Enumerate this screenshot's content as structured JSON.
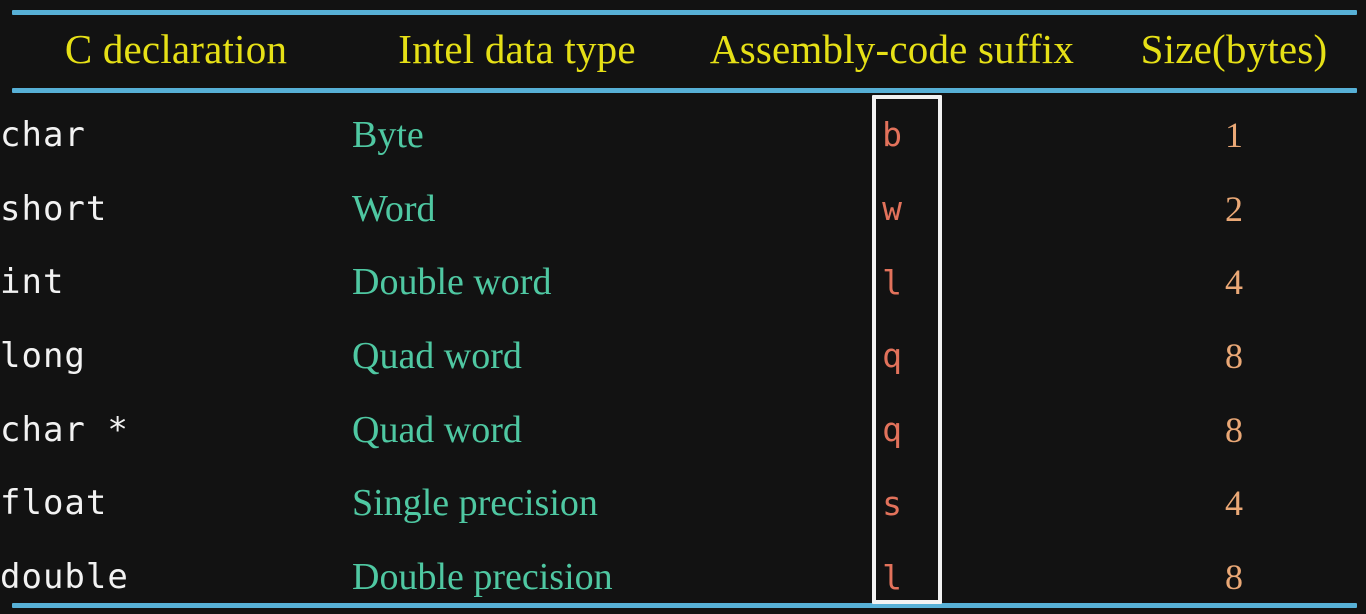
{
  "slide": {
    "background_color": "#121212",
    "rule_color": "#57b0d6",
    "header_color": "#e6e016",
    "declaration_color": "#f2f2f2",
    "intel_type_color": "#4fc8a2",
    "suffix_color": "#e2725b",
    "size_color": "#eaa876",
    "highlight_border_color": "#f2f2f2"
  },
  "table": {
    "headers": {
      "declaration": "C declaration",
      "intel_type": "Intel data type",
      "suffix": "Assembly-code suffix",
      "size": "Size(bytes)"
    },
    "rows": [
      {
        "declaration": "char",
        "intel_type": "Byte",
        "suffix": "b",
        "size": "1"
      },
      {
        "declaration": "short",
        "intel_type": "Word",
        "suffix": "w",
        "size": "2"
      },
      {
        "declaration": "int",
        "intel_type": "Double word",
        "suffix": "l",
        "size": "4"
      },
      {
        "declaration": "long",
        "intel_type": "Quad word",
        "suffix": "q",
        "size": "8"
      },
      {
        "declaration": "char *",
        "intel_type": "Quad word",
        "suffix": "q",
        "size": "8"
      },
      {
        "declaration": "float",
        "intel_type": "Single precision",
        "suffix": "s",
        "size": "4"
      },
      {
        "declaration": "double",
        "intel_type": "Double precision",
        "suffix": "l",
        "size": "8"
      }
    ],
    "highlight": {
      "column": "suffix",
      "label": "assembly-code-suffix-column-highlight"
    }
  }
}
